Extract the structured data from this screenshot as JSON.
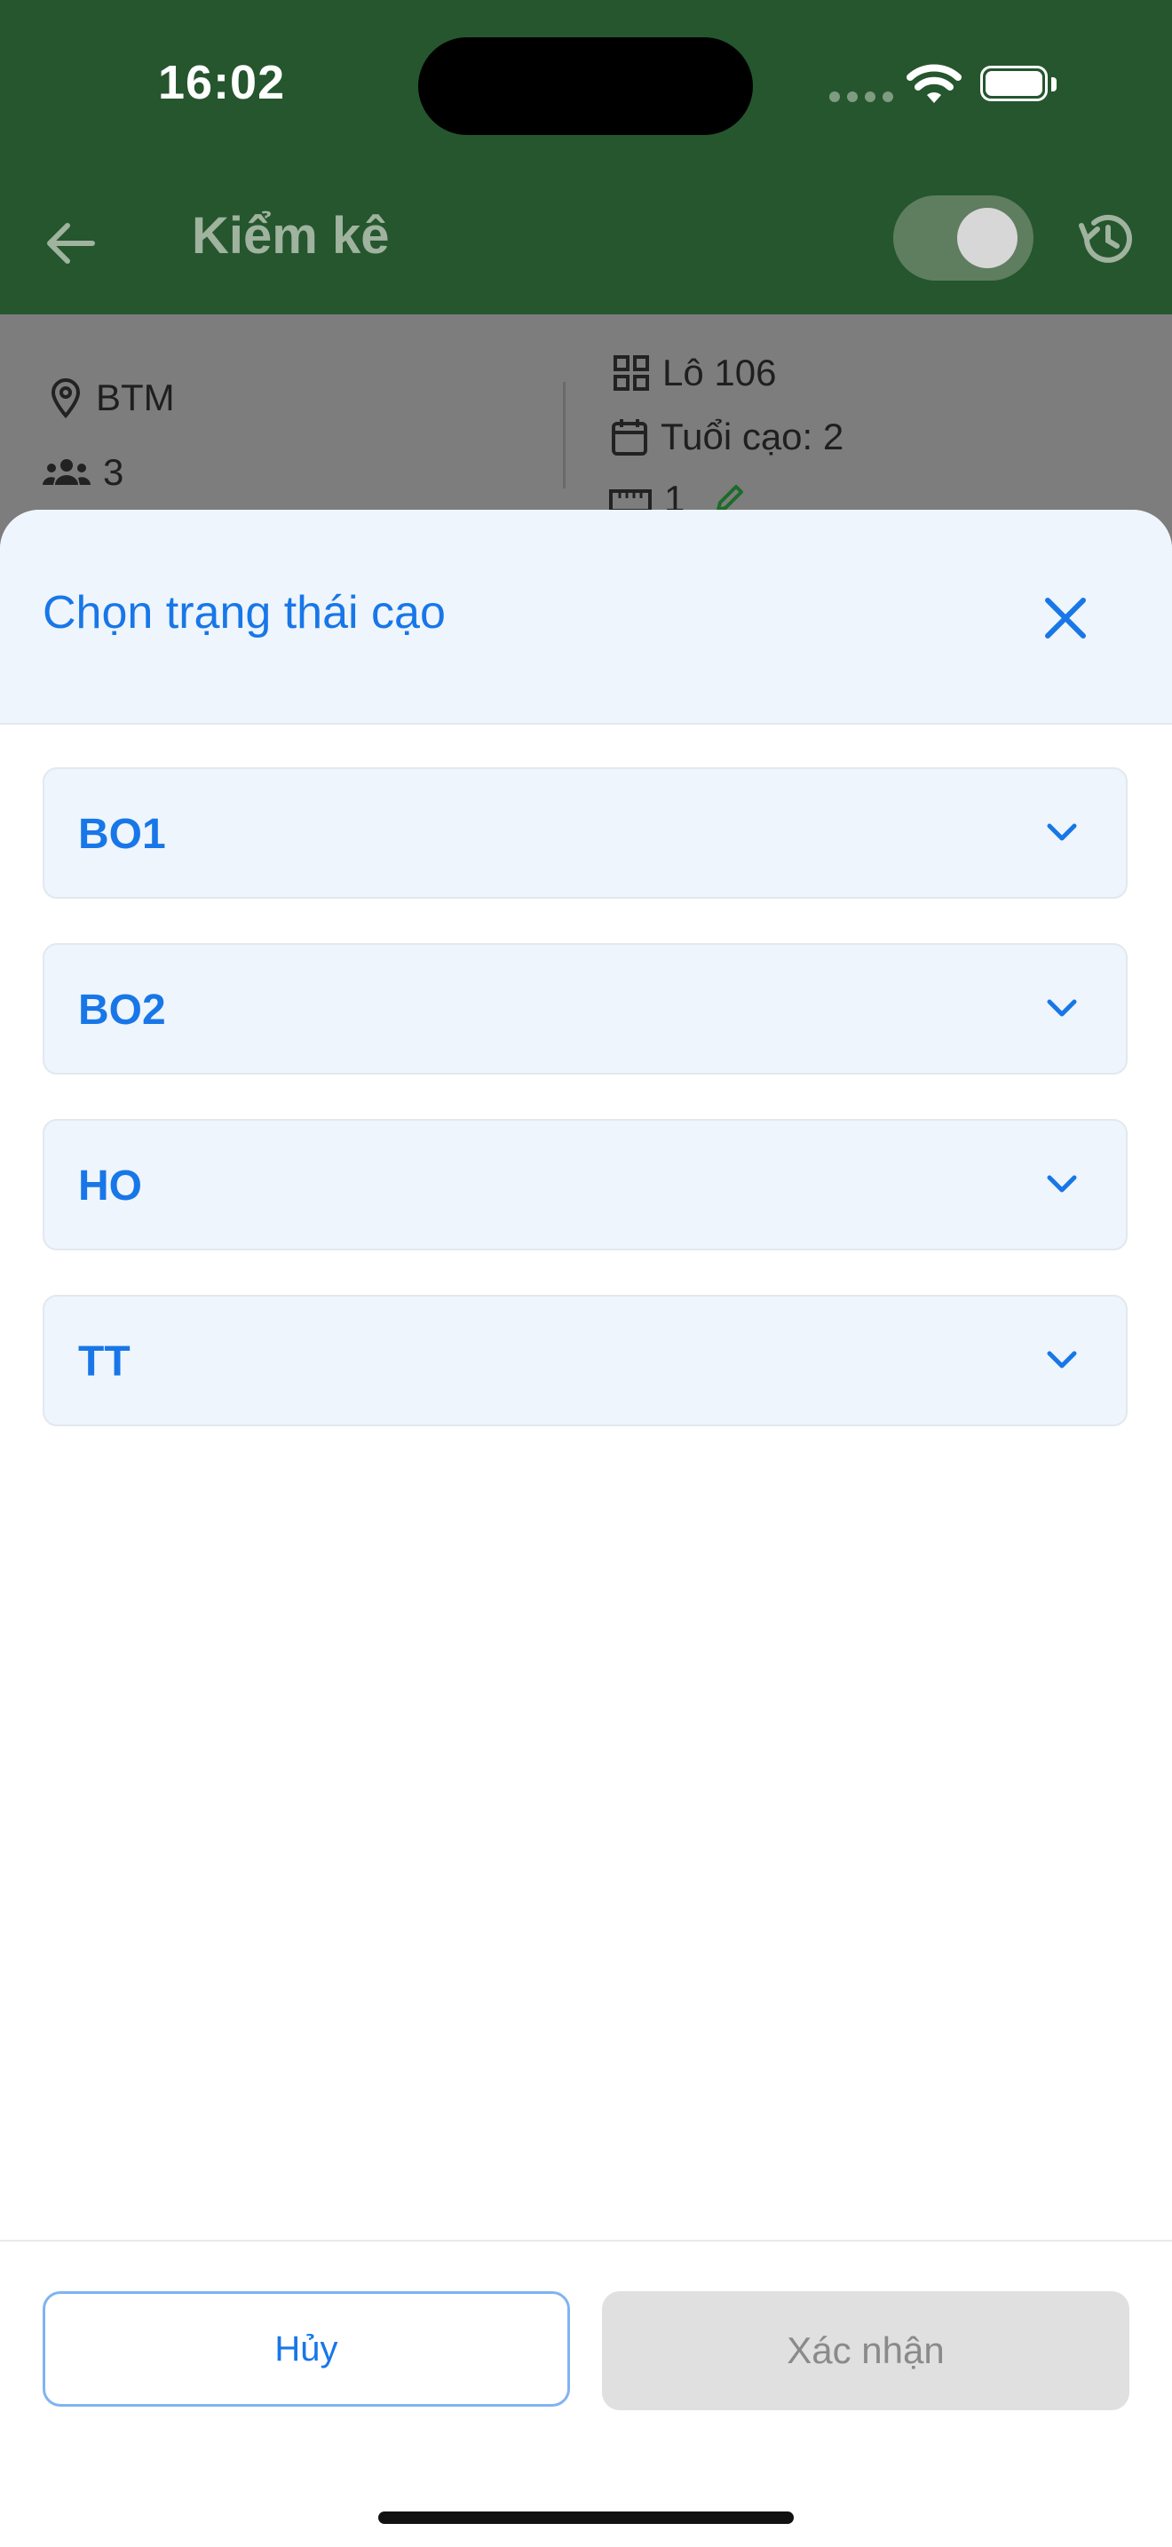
{
  "status_bar": {
    "time": "16:02"
  },
  "app_bar": {
    "title": "Kiểm kê"
  },
  "info": {
    "location": "BTM",
    "people": "3",
    "plot": "Lô 106",
    "tapping_age": "Tuổi cạo: 2",
    "measure": "1"
  },
  "sheet": {
    "title": "Chọn trạng thái cạo",
    "options": [
      {
        "label": "BO1"
      },
      {
        "label": "BO2"
      },
      {
        "label": "HO"
      },
      {
        "label": "TT"
      }
    ],
    "cancel_label": "Hủy",
    "confirm_label": "Xác nhận"
  },
  "colors": {
    "app_bar": "#25562e",
    "accent": "#1877e8",
    "sheet_header_bg": "#eff5fc",
    "disabled_button": "#e0e0e0"
  }
}
